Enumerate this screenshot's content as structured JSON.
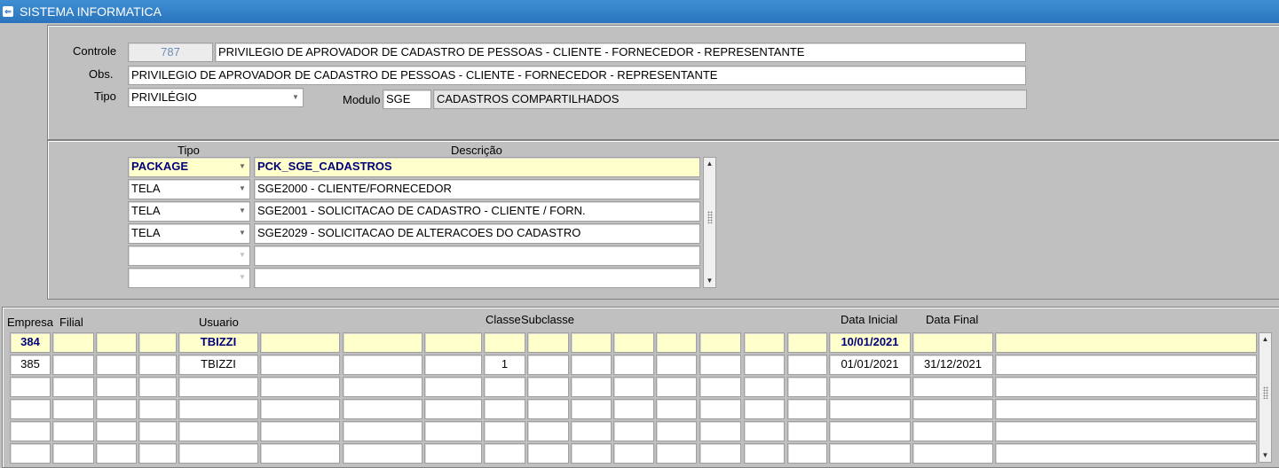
{
  "window": {
    "title": "SISTEMA INFORMATICA"
  },
  "header": {
    "controle_label": "Controle",
    "controle_value": "787",
    "controle_desc": "PRIVILEGIO DE APROVADOR DE CADASTRO DE PESSOAS - CLIENTE - FORNECEDOR - REPRESENTANTE",
    "obs_label": "Obs.",
    "obs_value": "PRIVILEGIO DE APROVADOR DE CADASTRO DE PESSOAS - CLIENTE - FORNECEDOR - REPRESENTANTE",
    "tipo_label": "Tipo",
    "tipo_value": "PRIVILÉGIO",
    "modulo_label": "Modulo",
    "modulo_value": "SGE",
    "modulo_desc": "CADASTROS COMPARTILHADOS"
  },
  "objects": {
    "col_tipo": "Tipo",
    "col_descricao": "Descrição",
    "rows": [
      {
        "tipo": "PACKAGE",
        "descricao": "PCK_SGE_CADASTROS"
      },
      {
        "tipo": "TELA",
        "descricao": "SGE2000 - CLIENTE/FORNECEDOR"
      },
      {
        "tipo": "TELA",
        "descricao": "SGE2001 - SOLICITACAO DE CADASTRO - CLIENTE / FORN."
      },
      {
        "tipo": "TELA",
        "descricao": "SGE2029 - SOLICITACAO DE ALTERACOES DO CADASTRO"
      },
      {
        "tipo": "",
        "descricao": ""
      },
      {
        "tipo": "",
        "descricao": ""
      }
    ]
  },
  "users": {
    "col_empresa": "Empresa",
    "col_filial": "Filial",
    "col_usuario": "Usuario",
    "col_classe": "Classe",
    "col_subclasse": "Subclasse",
    "col_data_inicial": "Data Inicial",
    "col_data_final": "Data Final",
    "rows": [
      {
        "empresa": "384",
        "usuario": "TBIZZI",
        "classe": "",
        "data_inicial": "10/01/2021",
        "data_final": ""
      },
      {
        "empresa": "385",
        "usuario": "TBIZZI",
        "classe": "1",
        "data_inicial": "01/01/2021",
        "data_final": "31/12/2021"
      },
      {
        "empresa": "",
        "usuario": "",
        "classe": "",
        "data_inicial": "",
        "data_final": ""
      },
      {
        "empresa": "",
        "usuario": "",
        "classe": "",
        "data_inicial": "",
        "data_final": ""
      },
      {
        "empresa": "",
        "usuario": "",
        "classe": "",
        "data_inicial": "",
        "data_final": ""
      },
      {
        "empresa": "",
        "usuario": "",
        "classe": "",
        "data_inicial": "",
        "data_final": ""
      }
    ]
  },
  "colors": {
    "titlebar": "#2a74bd",
    "background": "#c0c0c0",
    "current_row": "#ffffcc",
    "current_text": "#00007a"
  },
  "icons": {
    "window_icon": "form-icon",
    "dropdown": "chevron-down-icon",
    "scroll_up": "scroll-up-icon",
    "scroll_down": "scroll-down-icon"
  }
}
